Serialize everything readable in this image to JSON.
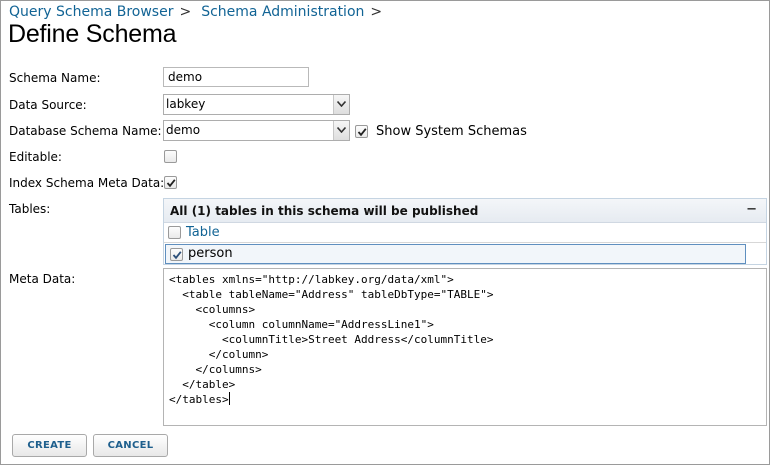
{
  "breadcrumb": {
    "items": [
      "Query Schema Browser",
      "Schema Administration"
    ],
    "separator": ">"
  },
  "page_title": "Define Schema",
  "form": {
    "schema_name": {
      "label": "Schema Name:",
      "value": "demo"
    },
    "data_source": {
      "label": "Data Source:",
      "value": "labkey"
    },
    "database_schema_name": {
      "label": "Database Schema Name:",
      "value": "demo"
    },
    "show_system_schemas": {
      "label": "Show System Schemas",
      "checked": true
    },
    "editable": {
      "label": "Editable:",
      "checked": false
    },
    "index_schema_meta_data": {
      "label": "Index Schema Meta Data:",
      "checked": true
    },
    "tables": {
      "label": "Tables:",
      "header": "All (1) tables in this schema will be published",
      "collapse_glyph": "−",
      "column_header": "Table",
      "rows": [
        {
          "name": "person",
          "checked": true
        }
      ]
    },
    "meta_data": {
      "label": "Meta Data:",
      "lines": [
        "<tables xmlns=\"http://labkey.org/data/xml\">",
        "  <table tableName=\"Address\" tableDbType=\"TABLE\">",
        "    <columns>",
        "      <column columnName=\"AddressLine1\">",
        "        <columnTitle>Street Address</columnTitle>",
        "      </column>",
        "    </columns>",
        "  </table>",
        "</tables>"
      ]
    }
  },
  "buttons": {
    "create": "CREATE",
    "cancel": "CANCEL"
  },
  "colors": {
    "link": "#126495",
    "button_text": "#1e5f8d",
    "selected_row_border": "#5f8fbf"
  }
}
